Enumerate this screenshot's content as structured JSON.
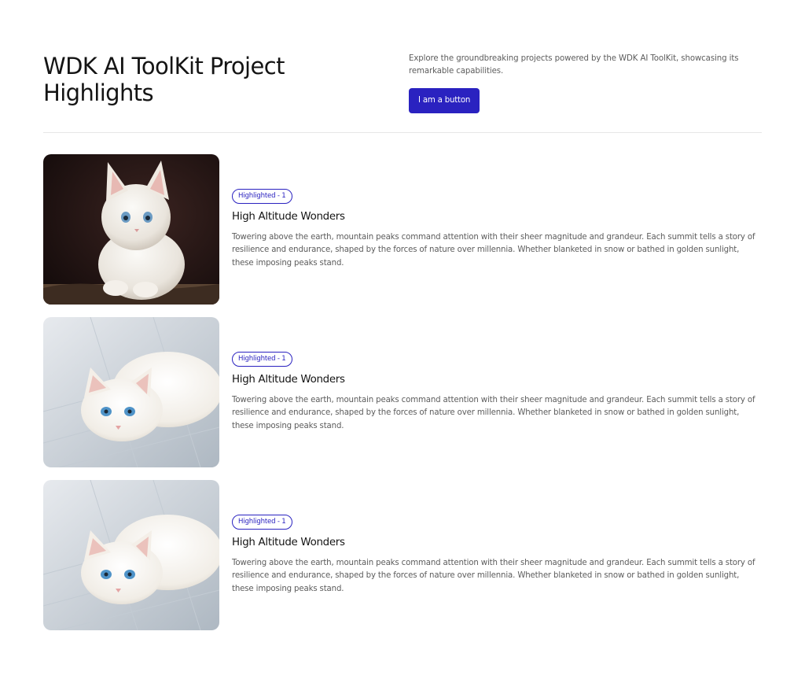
{
  "header": {
    "title": "WDK AI ToolKit Project Highlights",
    "description": "Explore the groundbreaking projects powered by the WDK AI ToolKit, showcasing its remarkable capabilities.",
    "button_label": "I am a button"
  },
  "colors": {
    "accent": "#2a22c0",
    "title": "#141414",
    "body_text": "#5c5c5c",
    "divider": "#e6e6e6"
  },
  "highlights": [
    {
      "image": "kitten-sitting-photo",
      "badge": "Highlighted - 1",
      "title": "High Altitude Wonders",
      "description": "Towering above the earth, mountain peaks command attention with their sheer magnitude and grandeur. Each summit tells a story of resilience and endurance, shaped by the forces of nature over millennia. Whether blanketed in snow or bathed in golden sunlight, these imposing peaks stand."
    },
    {
      "image": "kitten-lying-photo",
      "badge": "Highlighted - 1",
      "title": "High Altitude Wonders",
      "description": "Towering above the earth, mountain peaks command attention with their sheer magnitude and grandeur. Each summit tells a story of resilience and endurance, shaped by the forces of nature over millennia. Whether blanketed in snow or bathed in golden sunlight, these imposing peaks stand."
    },
    {
      "image": "kitten-lying-photo",
      "badge": "Highlighted - 1",
      "title": "High Altitude Wonders",
      "description": "Towering above the earth, mountain peaks command attention with their sheer magnitude and grandeur. Each summit tells a story of resilience and endurance, shaped by the forces of nature over millennia. Whether blanketed in snow or bathed in golden sunlight, these imposing peaks stand."
    }
  ]
}
